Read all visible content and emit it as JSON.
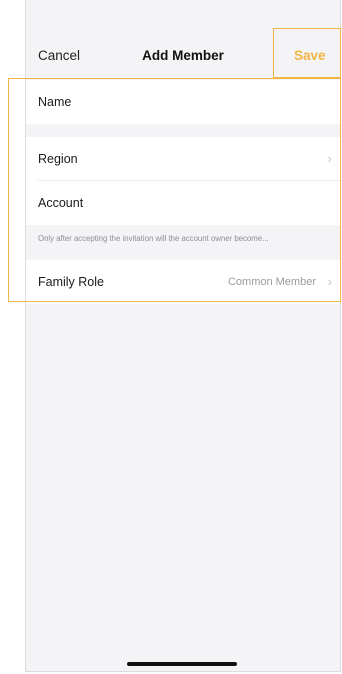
{
  "header": {
    "cancel_label": "Cancel",
    "title": "Add Member",
    "save_label": "Save"
  },
  "form": {
    "name": {
      "label": "Name"
    },
    "region": {
      "label": "Region"
    },
    "account": {
      "label": "Account"
    },
    "hint": "Only after accepting the invitation will the account owner become...",
    "family_role": {
      "label": "Family Role",
      "value": "Common Member"
    }
  },
  "icons": {
    "chevron": "›"
  },
  "colors": {
    "accent": "#f2b544",
    "background": "#f4f4f6",
    "card": "#ffffff"
  }
}
